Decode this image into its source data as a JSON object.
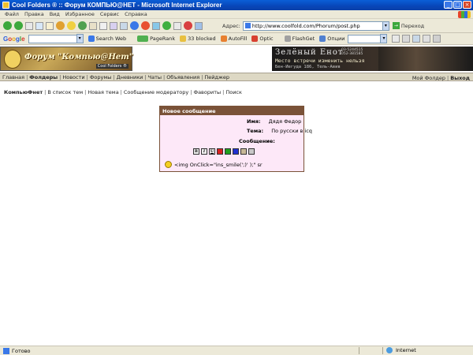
{
  "window": {
    "title": "Cool Folders ® :: Форум КОМПЬЮ@НЕТ - Microsoft Internet Explorer",
    "controls": [
      "_",
      "□",
      "×"
    ]
  },
  "menu": [
    "Файл",
    "Правка",
    "Вид",
    "Избранное",
    "Сервис",
    "Справка"
  ],
  "address_bar": {
    "label": "Адрес:",
    "url": "http://www.coolfold.com/Phorum/post.php",
    "go_label": "Переход"
  },
  "google_toolbar": {
    "logo": "Google",
    "search_web": "Search Web",
    "pagerank": "PageRank",
    "blocked": "33 blocked",
    "autofill": "AutoFill",
    "options": "Optic",
    "flashget": "FlashGet",
    "options2": "Опции"
  },
  "banner": {
    "logo_text": "Форум \"Компью@Нет\"",
    "logo_sub": "Cool Folders ®",
    "ad_title": "Зелёный Енот",
    "ad_line": "Место встречи изменить нельзя",
    "ad_addr": "Бен-Иегуда 186, Тель-Авив",
    "ad_phones": [
      "03-5244515",
      "052-381585"
    ]
  },
  "nav": {
    "left": [
      "Главная",
      "Фолдеры",
      "Новости",
      "Форумы",
      "Дневники",
      "Чаты",
      "Объявления",
      "Пейджер"
    ],
    "active_index": 1,
    "right": [
      "Мой Фолдер",
      "Выход"
    ]
  },
  "subnav": [
    "КомпьюФнет",
    "В список тем",
    "Новая тема",
    "Сообщение модератору",
    "Фавориты",
    "Поиск"
  ],
  "post_form": {
    "header": "Новое сообщение",
    "name_label": "Имя:",
    "name_value": "Дядя Федор",
    "topic_label": "Тема:",
    "topic_value": "По русски в icq",
    "message_label": "Сообщение:",
    "format_buttons": [
      "B",
      "I",
      "U",
      "",
      "",
      "",
      "",
      ""
    ],
    "format_colors": [
      "#eeeeee",
      "#eeeeee",
      "#eeeeee",
      "#d82020",
      "#20a020",
      "#2030d0",
      "#c8b898",
      "#c8c8c8"
    ],
    "smile_code": "<img OnClick=\"ins_smile(';)' );\" sr"
  },
  "status": {
    "text": "Готово",
    "zone": "Internet"
  }
}
